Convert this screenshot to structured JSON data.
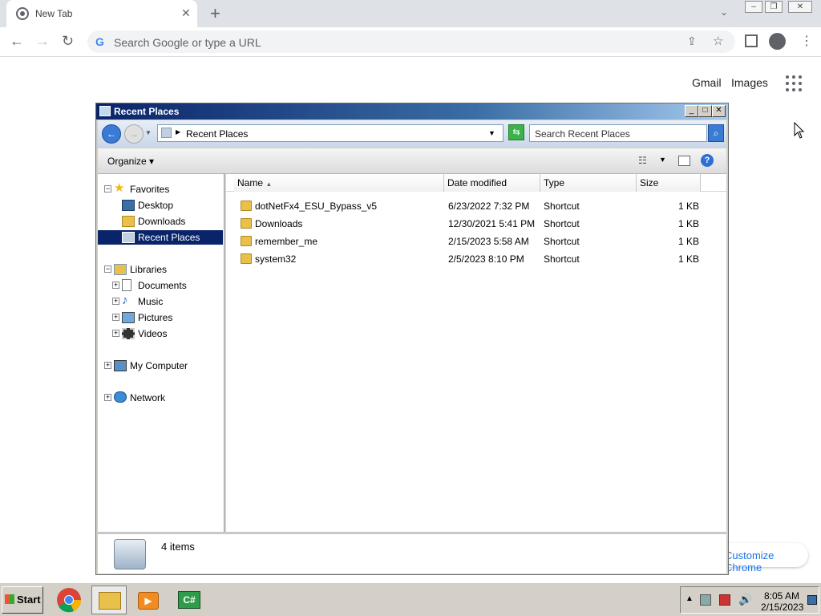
{
  "browser": {
    "tab_title": "New Tab",
    "omnibox_placeholder": "Search Google or type a URL",
    "links": {
      "gmail": "Gmail",
      "images": "Images"
    },
    "customize": "Customize Chrome"
  },
  "explorer": {
    "title": "Recent Places",
    "address": "Recent Places",
    "search_placeholder": "Search Recent Places",
    "organize": "Organize",
    "nav": {
      "favorites": "Favorites",
      "desktop": "Desktop",
      "downloads": "Downloads",
      "recent_places": "Recent Places",
      "libraries": "Libraries",
      "documents": "Documents",
      "music": "Music",
      "pictures": "Pictures",
      "videos": "Videos",
      "my_computer": "My Computer",
      "network": "Network"
    },
    "columns": {
      "name": "Name",
      "date": "Date modified",
      "type": "Type",
      "size": "Size"
    },
    "files": [
      {
        "name": "dotNetFx4_ESU_Bypass_v5",
        "date": "6/23/2022 7:32 PM",
        "type": "Shortcut",
        "size": "1 KB"
      },
      {
        "name": "Downloads",
        "date": "12/30/2021 5:41 PM",
        "type": "Shortcut",
        "size": "1 KB"
      },
      {
        "name": "remember_me",
        "date": "2/15/2023 5:58 AM",
        "type": "Shortcut",
        "size": "1 KB"
      },
      {
        "name": "system32",
        "date": "2/5/2023 8:10 PM",
        "type": "Shortcut",
        "size": "1 KB"
      }
    ],
    "status": "4 items"
  },
  "taskbar": {
    "start": "Start",
    "apps": [
      "chrome-icon",
      "explorer-icon",
      "media-player-icon",
      "csharp-icon"
    ],
    "csharp_label": "C#",
    "time": "8:05 AM",
    "date": "2/15/2023"
  }
}
